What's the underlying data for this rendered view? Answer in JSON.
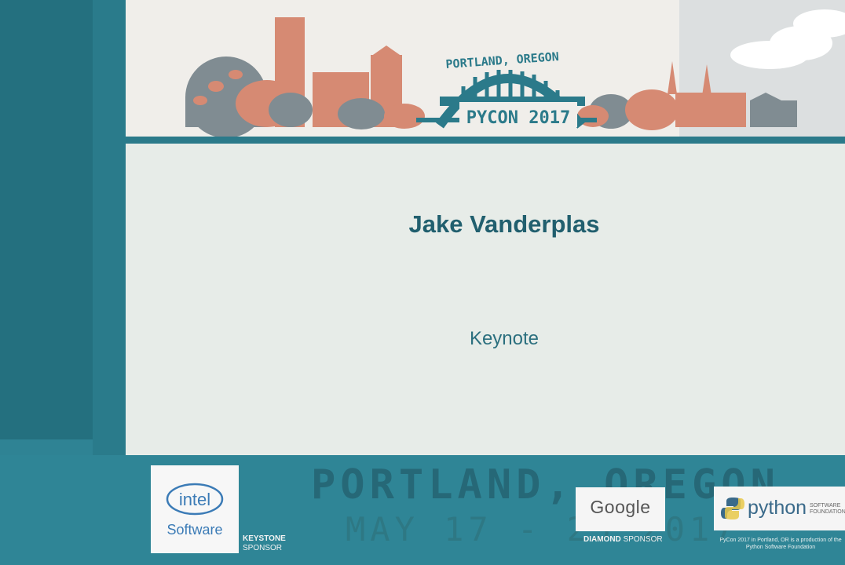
{
  "event": {
    "city_label": "PORTLAND, OREGON",
    "logo_title": "PYCON 2017"
  },
  "slide": {
    "speaker": "Jake Vanderplas",
    "session_type": "Keynote"
  },
  "background": {
    "city": "PORTLAND, OREGON",
    "dates": "MAY 17 - 25 2017"
  },
  "sponsors": {
    "intel": {
      "logo_text": "intel",
      "product": "Software",
      "tier_bold": "KEYSTONE",
      "tier_rest": "SPONSOR"
    },
    "google": {
      "logo_text": "Google",
      "tier_bold": "DIAMOND",
      "tier_rest": "SPONSOR"
    },
    "psf": {
      "logo_text": "python",
      "sub": "SOFTWARE FOUNDATION",
      "note": "PyCon 2017 in Portland, OR is a production of the Python Software Foundation"
    }
  },
  "colors": {
    "teal_dark": "#215f6e",
    "teal": "#2f8394",
    "salmon": "#d98c74",
    "slate": "#7e8a90"
  }
}
